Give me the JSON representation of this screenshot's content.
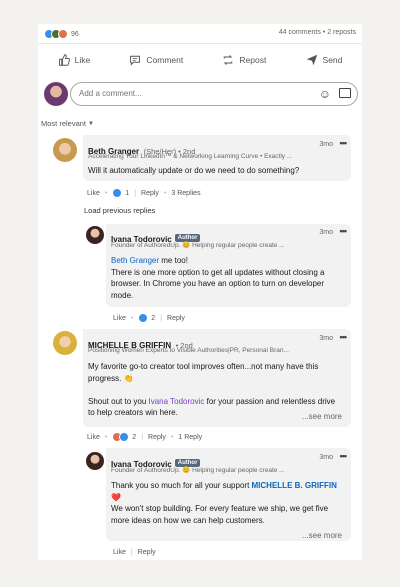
{
  "stats": {
    "reactions": "96",
    "comments": "44 comments",
    "reposts": "2 reposts",
    "separator": "•"
  },
  "actions": {
    "like": "Like",
    "comment": "Comment",
    "repost": "Repost",
    "send": "Send"
  },
  "composer": {
    "placeholder": "Add a comment..."
  },
  "sort": {
    "label": "Most relevant"
  },
  "comments": [
    {
      "name": "Beth Granger",
      "pronoun": "(She/Her) • 2nd",
      "headline": "Accelerating Your LinkedIn™ & Networking Learning Curve • Exactly ...",
      "time": "3mo",
      "text": "Will it automatically update or do we need to do something?",
      "like": "Like",
      "reaction_count": "1",
      "reply": "Reply",
      "replies": "3 Replies"
    },
    {
      "load_previous": "Load previous replies",
      "name": "Ivana Todorovic",
      "badge": "Author",
      "headline": "Founder of AuthoredUp. 😊 Helping regular people create ...",
      "time": "3mo",
      "mention": "Beth Granger",
      "text1": " me too!",
      "text2": "There is one more option to get all updates without closing a browser. In Chrome you have an option to turn on developer mode.",
      "like": "Like",
      "reaction_count": "2",
      "reply": "Reply"
    },
    {
      "name": "MICHELLE B GRIFFIN",
      "pronoun": "• 2nd",
      "headline": "Positioning Women Experts to Visible Authorities|PR, Personal Bran...",
      "time": "3mo",
      "text1": "My favorite go-to creator tool improves often...not many have this progress. 👏",
      "text2_pre": "Shout out to you ",
      "mention": "Ivana Todorovic",
      "text2_post": " for your passion and relentless drive to help creators win here.",
      "see_more": "...see more",
      "like": "Like",
      "reaction_count": "2",
      "reply": "Reply",
      "replies": "1 Reply"
    },
    {
      "name": "Ivana Todorovic",
      "badge": "Author",
      "headline": "Founder of AuthoredUp. 😊 Helping regular people create ...",
      "time": "3mo",
      "text_pre": "Thank you so much for all your support ",
      "mention": "MICHELLE B. GRIFFIN",
      "heart": "❤️",
      "text2": "We won't stop building. For every feature we ship, we get five more ideas on how we can help customers.",
      "see_more": "...see more",
      "like": "Like",
      "reply": "Reply"
    }
  ],
  "colors": {
    "like_blue": "#378fe9",
    "celebrate_green": "#44712e",
    "love_red": "#df704d",
    "badge": "#56687a",
    "mention": "#0a66c2"
  }
}
